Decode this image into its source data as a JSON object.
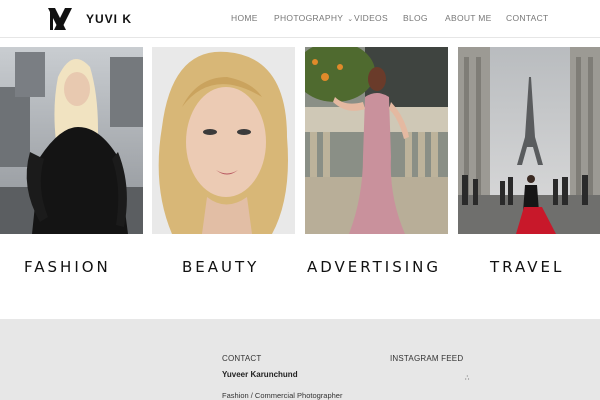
{
  "header": {
    "brand": "YUVI K",
    "nav": [
      {
        "label": "HOME"
      },
      {
        "label": "PHOTOGRAPHY"
      },
      {
        "label": "VIDEOS"
      },
      {
        "label": "BLOG"
      },
      {
        "label": "ABOUT ME"
      },
      {
        "label": "CONTACT"
      }
    ]
  },
  "gallery": {
    "categories": [
      {
        "label": "FASHION"
      },
      {
        "label": "BEAUTY"
      },
      {
        "label": "ADVERTISING"
      },
      {
        "label": "TRAVEL"
      }
    ]
  },
  "footer": {
    "contact_heading": "CONTACT",
    "contact_name": "Yuveer Karunchund",
    "contact_role": "Fashion / Commercial Photographer",
    "instagram_heading": "INSTAGRAM FEED"
  },
  "colors": {
    "footer_bg": "#e7e7e7",
    "nav_text": "#777777",
    "accent_red": "#c8182a"
  },
  "icons": {
    "logo": "yk-monogram-icon",
    "nav_dropdown": "chevron-down-icon",
    "instagram_loading": "spinner-icon"
  }
}
